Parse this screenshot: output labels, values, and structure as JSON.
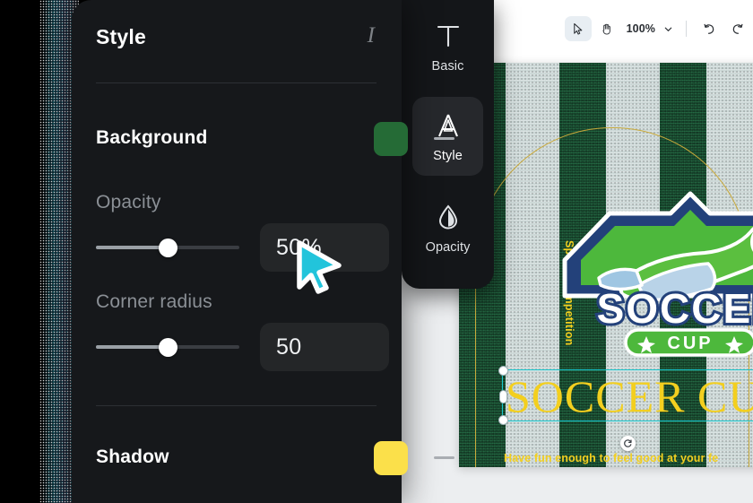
{
  "panel": {
    "title": "Style",
    "italic_icon": "italic-icon",
    "background": {
      "label": "Background",
      "color": "#256B36",
      "remove_label": "—"
    },
    "opacity": {
      "label": "Opacity",
      "value": "50%",
      "slider_percent": 50
    },
    "corner_radius": {
      "label": "Corner radius",
      "value": "50",
      "slider_percent": 50
    },
    "shadow": {
      "label": "Shadow",
      "color": "#FBE04A",
      "remove_label": "—"
    }
  },
  "rail": {
    "items": [
      {
        "label": "Basic",
        "icon": "text-basic-icon",
        "selected": false
      },
      {
        "label": "Style",
        "icon": "letter-a-style-icon",
        "selected": true
      },
      {
        "label": "Opacity",
        "icon": "droplet-opacity-icon",
        "selected": false
      }
    ]
  },
  "toolbar": {
    "select_tool": "select-arrow-icon",
    "hand_tool": "hand-icon",
    "zoom": "100%",
    "zoom_chevron": "chevron-down-icon",
    "undo": "undo-icon",
    "redo": "redo-icon"
  },
  "poster": {
    "side_label": "Sports competition",
    "logo_title": "SOCCER",
    "logo_subtitle": "CUP",
    "headline": "SOCCER CU",
    "tagline": "Have fun enough to feel good at your fe",
    "headline_color": "#F3CF1F",
    "selection_color": "#17C8CF"
  },
  "cursor": {
    "type": "arrow-pointer",
    "color": "#22C4DB"
  }
}
